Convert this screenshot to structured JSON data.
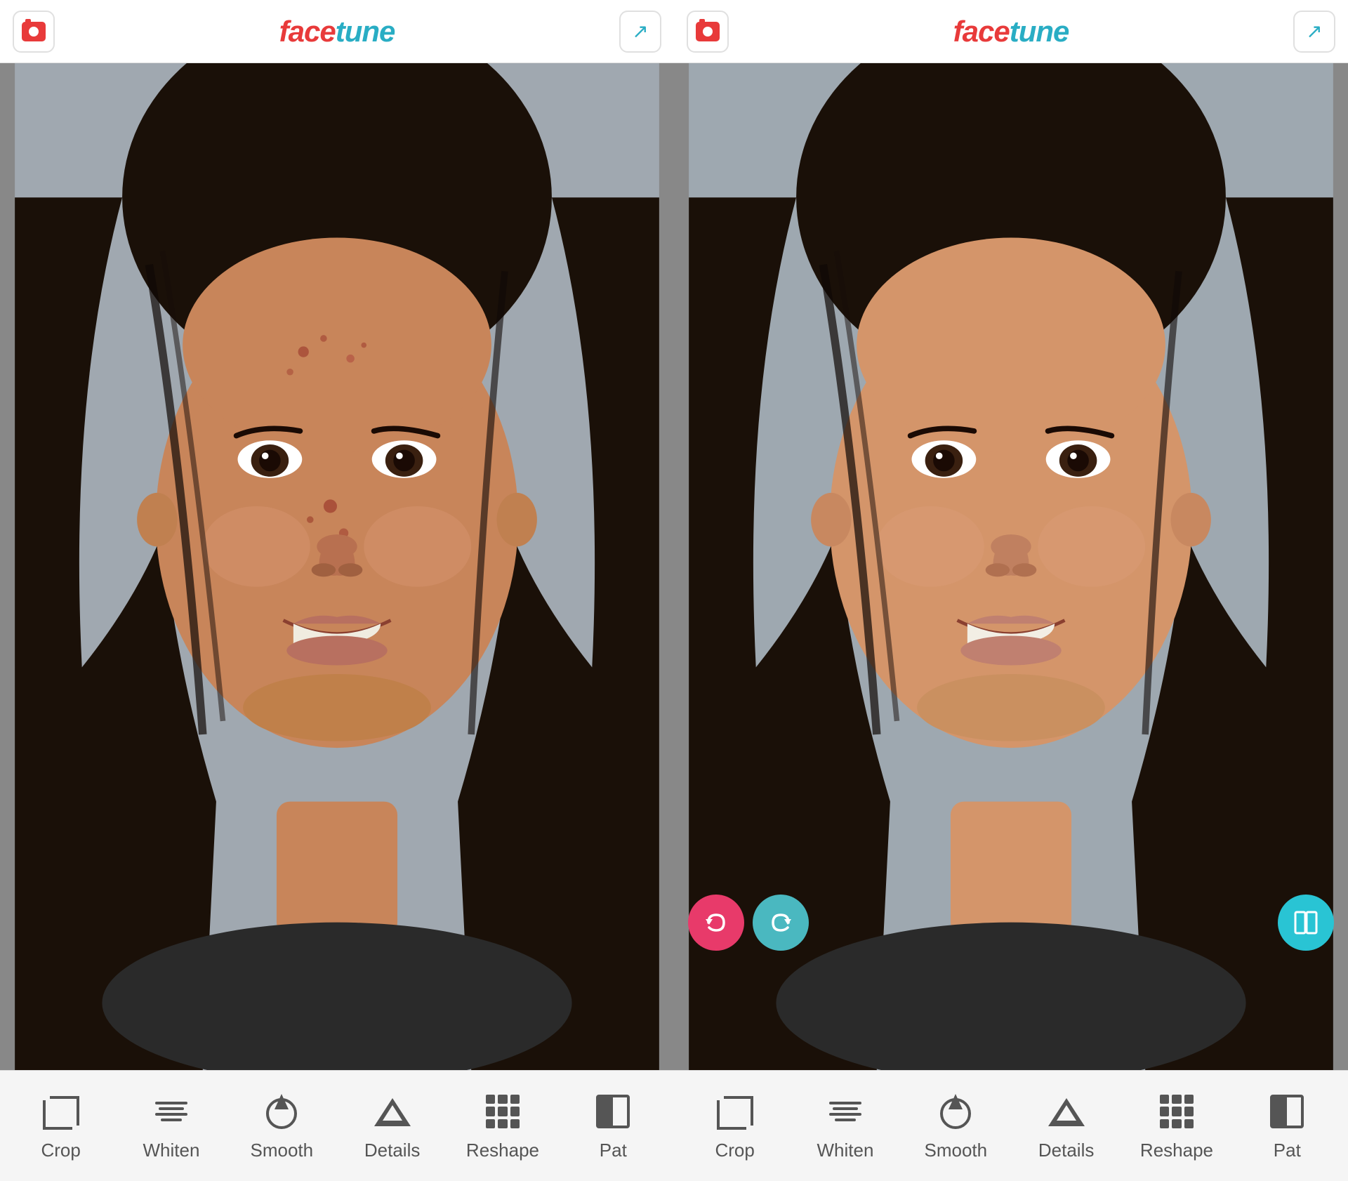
{
  "panels": [
    {
      "id": "before",
      "header": {
        "camera_button_label": "camera",
        "logo_face": "face",
        "logo_tune": "tune",
        "share_button_label": "share"
      },
      "toolbar": {
        "items": [
          {
            "id": "crop",
            "label": "Crop"
          },
          {
            "id": "whiten",
            "label": "Whiten"
          },
          {
            "id": "smooth",
            "label": "Smooth"
          },
          {
            "id": "details",
            "label": "Details"
          },
          {
            "id": "reshape",
            "label": "Reshape"
          },
          {
            "id": "patch",
            "label": "Pat"
          }
        ]
      },
      "has_fab": false
    },
    {
      "id": "after",
      "header": {
        "camera_button_label": "camera",
        "logo_face": "face",
        "logo_tune": "tune",
        "share_button_label": "share"
      },
      "toolbar": {
        "items": [
          {
            "id": "crop",
            "label": "Crop"
          },
          {
            "id": "whiten",
            "label": "Whiten"
          },
          {
            "id": "smooth",
            "label": "Smooth"
          },
          {
            "id": "details",
            "label": "Details"
          },
          {
            "id": "reshape",
            "label": "Reshape"
          },
          {
            "id": "patch",
            "label": "Pat"
          }
        ]
      },
      "has_fab": true,
      "fab": {
        "undo_label": "↩",
        "redo_label": "↪",
        "compare_label": "⧉"
      }
    }
  ],
  "colors": {
    "accent_red": "#e83a3a",
    "accent_cyan": "#29adc4",
    "logo_red": "#e83a3a",
    "logo_blue": "#29adc4",
    "fab_undo": "#e83a6a",
    "fab_redo": "#4ab8c0",
    "fab_compare": "#29c4d4"
  }
}
